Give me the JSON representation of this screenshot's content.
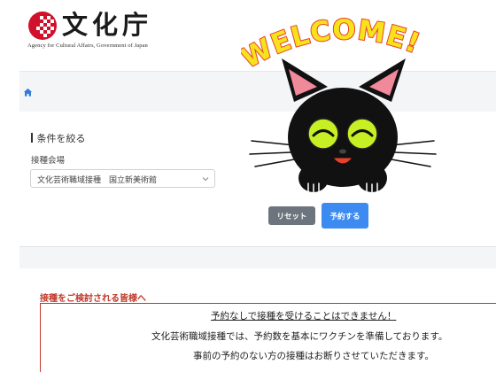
{
  "header": {
    "logo_kanji": "文化庁",
    "logo_subtitle": "Agency for Cultural Affairs, Government of Japan",
    "logo_icon": "checkered-circle-logo"
  },
  "breadcrumb": {
    "home_icon": "home-icon"
  },
  "filter": {
    "title": "条件を絞る",
    "venue_label": "接種会場",
    "venue_value": "文化芸術職域接種　国立新美術館",
    "reset_label": "リセット",
    "reserve_label": "予約する"
  },
  "mascot": {
    "welcome_text": "WELCOME!"
  },
  "notice": {
    "heading": "接種をご検討される皆様へ",
    "line1": "予約なしで接種を受けることはできません！",
    "line2": "文化芸術職域接種では、予約数を基本にワクチンを準備しております。",
    "line3": "事前の予約のない方の接種はお断りさせていただきます。"
  },
  "colors": {
    "primary_button": "#3d8bf0",
    "secondary_button": "#6c757d",
    "notice_red": "#c0392b",
    "welcome_yellow": "#f7e21b",
    "welcome_red": "#e8412b"
  }
}
